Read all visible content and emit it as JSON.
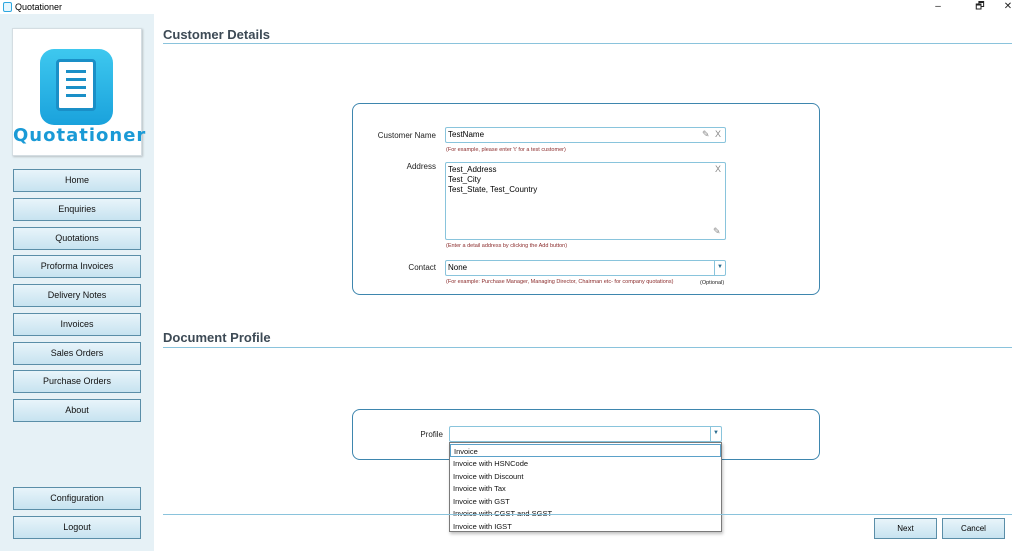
{
  "window": {
    "title": "Quotationer",
    "controls": {
      "minimize": "–",
      "maximize": "🗗",
      "close": "✕"
    }
  },
  "sidebar": {
    "logo_text": "Quotationer",
    "nav": [
      {
        "label": "Home"
      },
      {
        "label": "Enquiries"
      },
      {
        "label": "Quotations"
      },
      {
        "label": "Proforma Invoices"
      },
      {
        "label": "Delivery Notes"
      },
      {
        "label": "Invoices"
      },
      {
        "label": "Sales Orders"
      },
      {
        "label": "Purchase Orders"
      },
      {
        "label": "About"
      }
    ],
    "configuration_label": "Configuration",
    "logout_label": "Logout"
  },
  "customer_details": {
    "title": "Customer Details",
    "name_label": "Customer Name",
    "name_value": "TestName",
    "name_hint": "(For example, please enter 't' for a test customer)",
    "address_label": "Address",
    "address_lines": [
      "Test_Address",
      "Test_City",
      "Test_State, Test_Country"
    ],
    "address_hint": "(Enter a detail address by clicking the Add button)",
    "contact_label": "Contact",
    "contact_value": "None",
    "contact_hint": "(For example: Purchase Manager, Managing Director, Chairman etc- for company quotations)",
    "contact_optional": "(Optional)"
  },
  "document_profile": {
    "title": "Document Profile",
    "profile_label": "Profile",
    "profile_value": "",
    "options": [
      "Invoice",
      "Invoice with HSNCode",
      "Invoice with Discount",
      "Invoice with Tax",
      "Invoice with GST",
      "Invoice with CGST and SGST",
      "Invoice with IGST"
    ]
  },
  "actions": {
    "next": "Next",
    "cancel": "Cancel"
  },
  "icons": {
    "edit": "pencil-icon",
    "clear": "clear-icon",
    "dropdown": "chevron-down-icon"
  }
}
